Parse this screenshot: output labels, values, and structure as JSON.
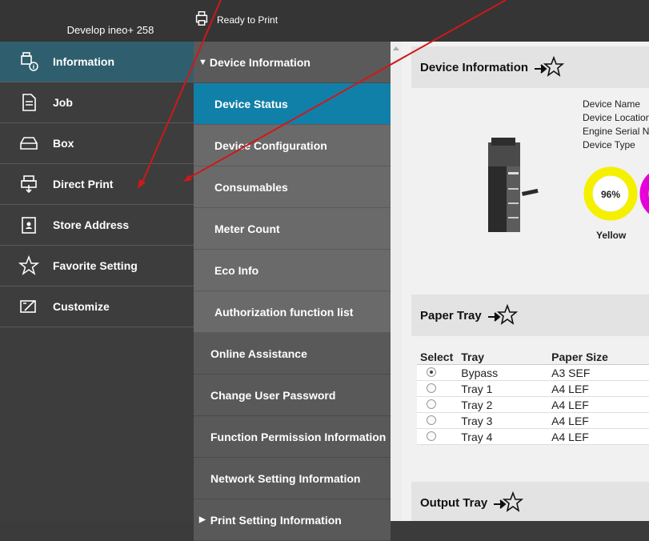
{
  "header": {
    "model": "Develop ineo+ 258",
    "status": "Ready to Print"
  },
  "sidebar": {
    "items": [
      {
        "label": "Information",
        "icon": "information-icon",
        "active": true
      },
      {
        "label": "Job",
        "icon": "job-icon"
      },
      {
        "label": "Box",
        "icon": "box-icon"
      },
      {
        "label": "Direct Print",
        "icon": "direct-print-icon"
      },
      {
        "label": "Store Address",
        "icon": "store-address-icon"
      },
      {
        "label": "Favorite Setting",
        "icon": "star-icon"
      },
      {
        "label": "Customize",
        "icon": "customize-icon"
      }
    ]
  },
  "subnav": {
    "group": "Device Information",
    "items": [
      {
        "label": "Device Status",
        "active": true
      },
      {
        "label": "Device Configuration"
      },
      {
        "label": "Consumables"
      },
      {
        "label": "Meter Count"
      },
      {
        "label": "Eco Info"
      },
      {
        "label": "Authorization function list"
      }
    ],
    "top_items": [
      {
        "label": "Online Assistance"
      },
      {
        "label": "Change User Password"
      },
      {
        "label": "Function Permission Information"
      },
      {
        "label": "Network Setting Information"
      }
    ],
    "collapsed": "Print Setting Information"
  },
  "device_info": {
    "title": "Device Information",
    "fields": [
      "Device Name",
      "Device Location",
      "Engine Serial Number",
      "Device Type"
    ],
    "toner": [
      {
        "label": "Yellow",
        "percent": "96%",
        "color": "#f5ef00"
      },
      {
        "label": "",
        "percent": "",
        "color": "#e800d8"
      }
    ]
  },
  "paper_tray": {
    "title": "Paper Tray",
    "headers": [
      "Select",
      "Tray",
      "Paper Size"
    ],
    "rows": [
      {
        "tray": "Bypass",
        "size": "A3 SEF",
        "selected": true
      },
      {
        "tray": "Tray 1",
        "size": "A4 LEF",
        "selected": false
      },
      {
        "tray": "Tray 2",
        "size": "A4 LEF",
        "selected": false
      },
      {
        "tray": "Tray 3",
        "size": "A4 LEF",
        "selected": false
      },
      {
        "tray": "Tray 4",
        "size": "A4 LEF",
        "selected": false
      }
    ]
  },
  "output_tray": {
    "title": "Output Tray"
  },
  "colors": {
    "active_sidebar": "#2f5f6e",
    "active_subnav": "#1180a8",
    "annotation_arrow": "#d01818"
  }
}
